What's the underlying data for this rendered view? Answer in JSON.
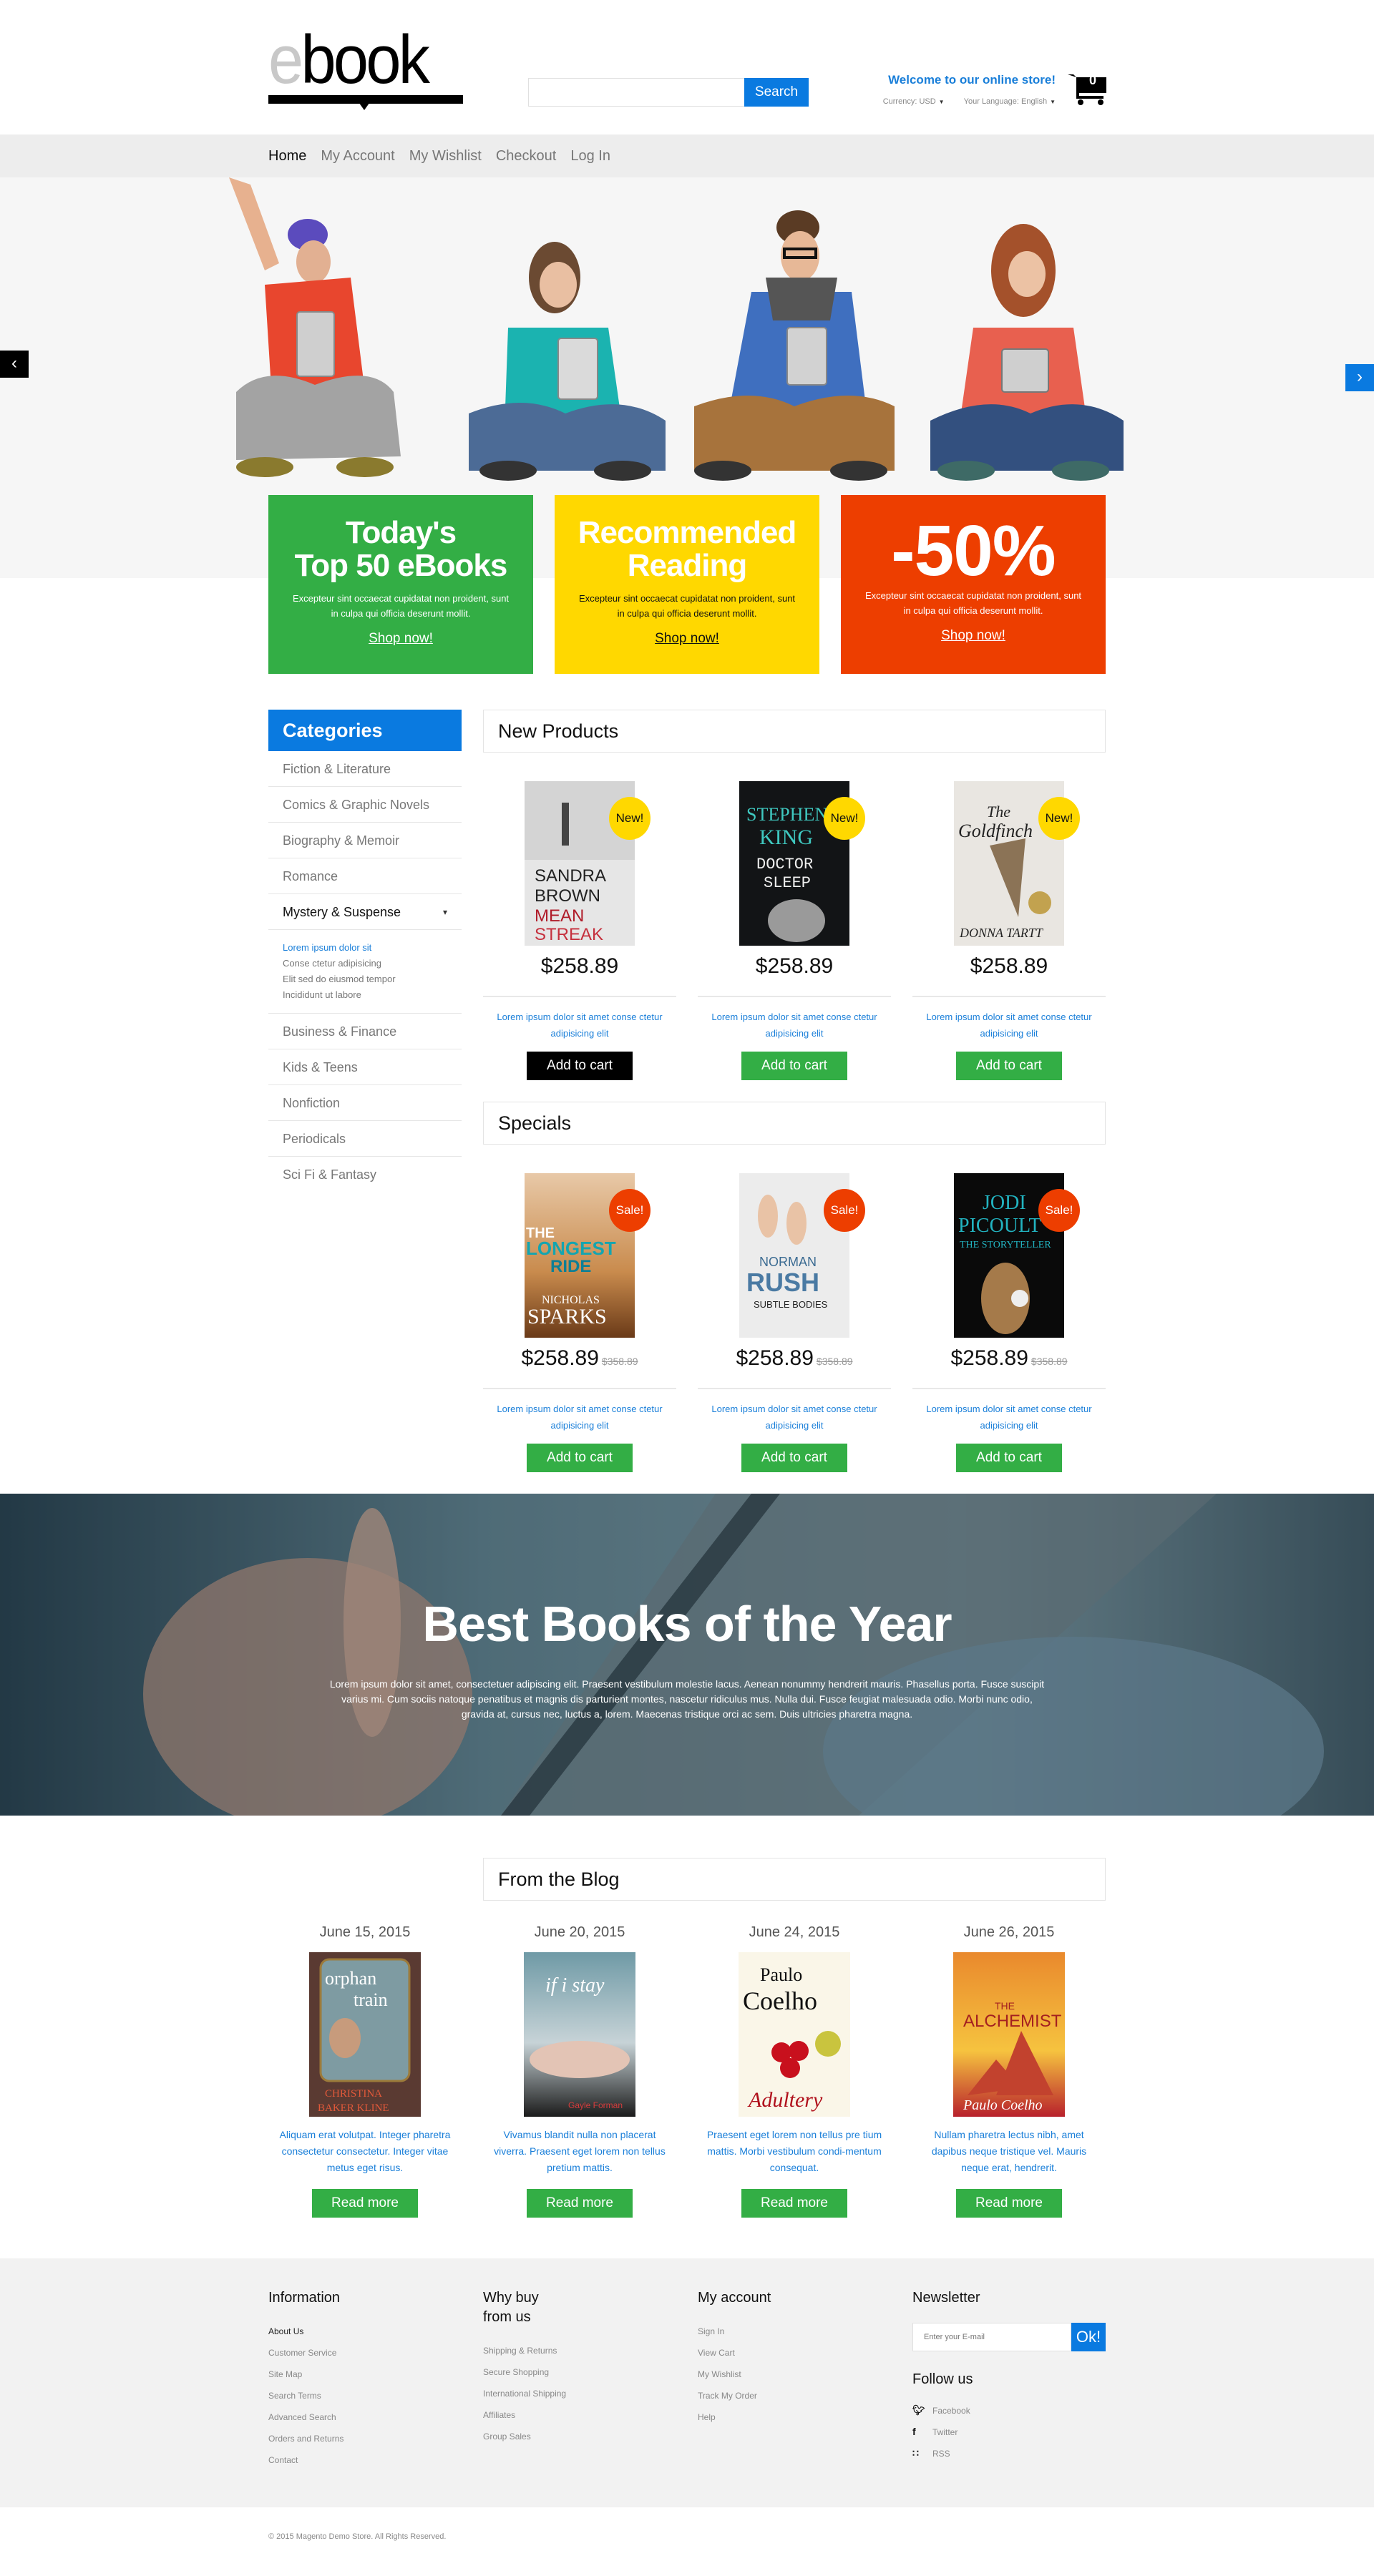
{
  "header": {
    "logo": {
      "e": "e",
      "rest": "book"
    },
    "search": {
      "placeholder": "",
      "value": "",
      "button_label": "Search"
    },
    "welcome": "Welcome to our online store!",
    "currency": "Currency: USD",
    "language": "Your Language: English",
    "cart_count": "0"
  },
  "nav": {
    "items": [
      {
        "label": "Home",
        "active": true
      },
      {
        "label": "My Account"
      },
      {
        "label": "My Wishlist"
      },
      {
        "label": "Checkout"
      },
      {
        "label": "Log In"
      }
    ]
  },
  "hero": {
    "prev_label": "‹",
    "next_label": "›",
    "promos": [
      {
        "title": "Today's Top 50 eBooks",
        "title_lines": [
          "Today's",
          "Top 50 eBooks"
        ],
        "text": "Excepteur sint occaecat cupidatat non proident, sunt in culpa qui officia deserunt mollit.",
        "link": "Shop now!",
        "color": "#33ae45"
      },
      {
        "title": "Recommended Reading",
        "title_lines": [
          "Recommended",
          "Reading"
        ],
        "text": "Excepteur sint occaecat cupidatat non proident, sunt in culpa qui officia deserunt mollit.",
        "link": "Shop now!",
        "color": "#ffd800"
      },
      {
        "title": "-50%",
        "title_lines": [
          "-50%",
          ""
        ],
        "text": "Excepteur sint occaecat cupidatat non proident, sunt in culpa qui officia deserunt mollit.",
        "link": "Shop now!",
        "color": "#ed3e00"
      }
    ]
  },
  "sidebar": {
    "title": "Categories",
    "categories": [
      "Fiction & Literature",
      "Comics & Graphic Novels",
      "Biography & Memoir",
      "Romance",
      "Mystery & Suspense",
      "Business & Finance",
      "Kids & Teens",
      "Nonfiction",
      "Periodicals",
      "Sci Fi & Fantasy"
    ],
    "expanded_category": "Mystery & Suspense",
    "expanded_caret": "▾",
    "subcategories": [
      {
        "label": "Lorem ipsum dolor sit",
        "active": true
      },
      {
        "label": "Conse ctetur adipisicing"
      },
      {
        "label": "Elit sed do eiusmod tempor"
      },
      {
        "label": "Incididunt ut labore"
      }
    ]
  },
  "new_products": {
    "title": "New Products",
    "items": [
      {
        "book": "Mean Streak",
        "author": "Sandra Brown",
        "badge": "New!",
        "price": "$258.89",
        "desc": "Lorem ipsum dolor sit amet conse ctetur adipisicing elit",
        "button": "Add to cart",
        "button_state": "hover"
      },
      {
        "book": "Doctor Sleep",
        "author": "Stephen King",
        "badge": "New!",
        "price": "$258.89",
        "desc": "Lorem ipsum dolor sit amet conse ctetur adipisicing elit",
        "button": "Add to cart"
      },
      {
        "book": "The Goldfinch",
        "author": "Donna Tartt",
        "badge": "New!",
        "price": "$258.89",
        "desc": "Lorem ipsum dolor sit amet conse ctetur adipisicing elit",
        "button": "Add to cart"
      }
    ]
  },
  "specials": {
    "title": "Specials",
    "items": [
      {
        "book": "The Longest Ride",
        "author": "Nicholas Sparks",
        "badge": "Sale!",
        "price": "$258.89",
        "old_price": "$358.89",
        "desc": "Lorem ipsum dolor sit amet conse ctetur adipisicing elit",
        "button": "Add to cart"
      },
      {
        "book": "Subtle Bodies",
        "author": "Norman Rush",
        "badge": "Sale!",
        "price": "$258.89",
        "old_price": "$358.89",
        "desc": "Lorem ipsum dolor sit amet conse ctetur adipisicing elit",
        "button": "Add to cart"
      },
      {
        "book": "The Storyteller",
        "author": "Jodi Picoult",
        "badge": "Sale!",
        "price": "$258.89",
        "old_price": "$358.89",
        "desc": "Lorem ipsum dolor sit amet conse ctetur adipisicing elit",
        "button": "Add to cart"
      }
    ]
  },
  "banner": {
    "title": "Best Books of the Year",
    "text": "Lorem ipsum dolor sit amet, consectetuer adipiscing elit. Praesent vestibulum molestie lacus. Aenean nonummy hendrerit mauris. Phasellus porta. Fusce suscipit varius mi. Cum sociis natoque penatibus et magnis dis parturient montes, nascetur ridiculus mus. Nulla dui. Fusce feugiat malesuada odio. Morbi nunc odio, gravida at, cursus nec, luctus a, lorem. Maecenas tristique orci ac sem. Duis ultricies pharetra magna."
  },
  "blog": {
    "title": "From the Blog",
    "posts": [
      {
        "date": "June 15, 2015",
        "book": "Orphan Train",
        "author": "Christina Baker Kline",
        "text": "Aliquam erat volutpat. Integer pharetra consectetur consectetur. Integer vitae metus eget risus.",
        "button": "Read more"
      },
      {
        "date": "June 20, 2015",
        "book": "If I Stay",
        "author": "Gayle Forman",
        "text": "Vivamus blandit nulla non placerat viverra. Praesent eget lorem non tellus pretium mattis.",
        "button": "Read more"
      },
      {
        "date": "June 24, 2015",
        "book": "Adultery",
        "author": "Paulo Coelho",
        "text": "Praesent eget lorem non tellus pre tium mattis. Morbi vestibulum condi-mentum consequat.",
        "button": "Read more"
      },
      {
        "date": "June 26, 2015",
        "book": "The Alchemist",
        "author": "Paulo Coelho",
        "text": "Nullam pharetra lectus nibh, amet dapibus neque tristique vel. Mauris neque erat, hendrerit.",
        "button": "Read more"
      }
    ]
  },
  "footer": {
    "information": {
      "title": "Information",
      "links": [
        "About Us",
        "Customer Service",
        "Site Map",
        "Search Terms",
        "Advanced Search",
        "Orders and Returns",
        "Contact"
      ]
    },
    "why_buy": {
      "title": "Why buy from us",
      "title_lines": [
        "Why buy",
        "from us"
      ],
      "links": [
        "Shipping & Returns",
        "Secure Shopping",
        "International Shipping",
        "Affiliates",
        "Group Sales"
      ]
    },
    "my_account": {
      "title": "My account",
      "links": [
        "Sign In",
        "View Cart",
        "My Wishlist",
        "Track My Order",
        "Help"
      ]
    },
    "newsletter": {
      "title": "Newsletter",
      "placeholder": "Enter your E-mail",
      "button": "Ok!"
    },
    "follow": {
      "title": "Follow us",
      "links": [
        {
          "label": "Facebook",
          "icon": "twitter-bird-icon"
        },
        {
          "label": "Twitter",
          "icon": "facebook-f-icon"
        },
        {
          "label": "RSS",
          "icon": "rss-icon"
        }
      ]
    },
    "copyright": "© 2015 Magento Demo Store. All Rights Reserved."
  },
  "colors": {
    "accent_blue": "#0a7ae0",
    "link_blue": "#1a7fd9",
    "green": "#33ae45",
    "yellow": "#ffd800",
    "red": "#ed3e00"
  }
}
